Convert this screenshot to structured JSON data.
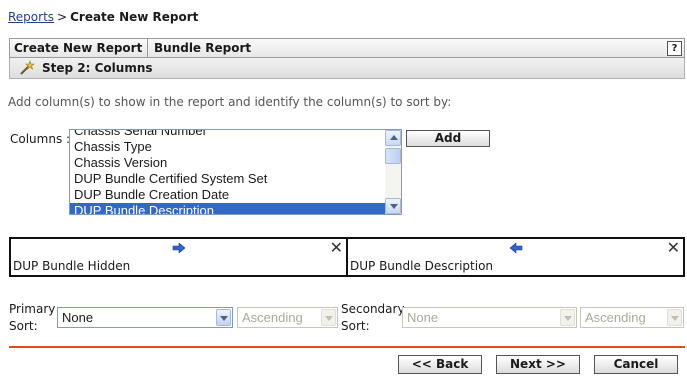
{
  "breadcrumb": {
    "link": "Reports",
    "separator": ">",
    "current": "Create New Report"
  },
  "header": {
    "cell1": "Create New Report",
    "cell2": "Bundle Report",
    "help": "?"
  },
  "step": {
    "label": "Step 2: Columns"
  },
  "instructions": "Add column(s) to show in the report and identify the column(s) to sort by:",
  "columns": {
    "label": "Columns :",
    "items": [
      "Chassis Serial Number",
      "Chassis Type",
      "Chassis Version",
      "DUP Bundle Certified System Set",
      "DUP Bundle Creation Date",
      "DUP Bundle Description"
    ],
    "selected_index": 5,
    "add_label": "Add"
  },
  "sort_boxes": [
    {
      "name": "DUP Bundle Hidden",
      "arrow": "right"
    },
    {
      "name": "DUP Bundle Description",
      "arrow": "left"
    }
  ],
  "primary_sort": {
    "label_line1": "Primary",
    "label_line2": "Sort:",
    "value": "None",
    "order": "Ascending"
  },
  "secondary_sort": {
    "label_line1": "Secondary",
    "label_line2": "Sort:",
    "value": "None",
    "order": "Ascending"
  },
  "nav": {
    "back": "<< Back",
    "next": "Next >>",
    "cancel": "Cancel"
  },
  "colors": {
    "accent_rule": "#d9501e",
    "selection": "#316ac5",
    "arrow": "#2f64c8"
  }
}
